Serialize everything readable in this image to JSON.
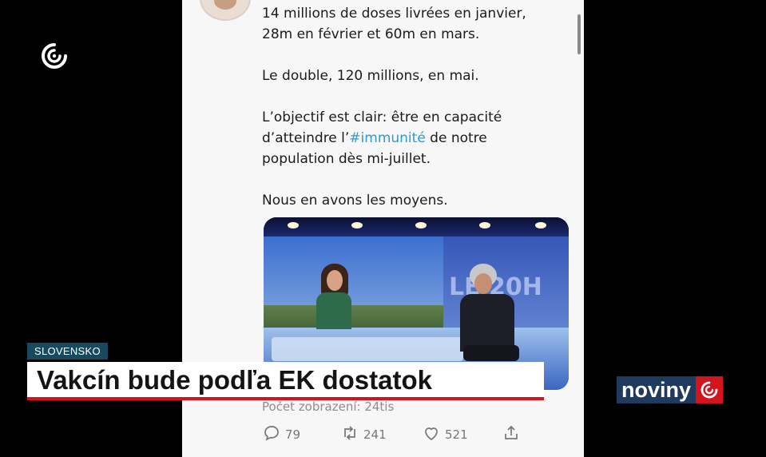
{
  "tweet": {
    "lines": [
      "14 millions de doses livrées en janvier,",
      "28m en février et 60m en mars.",
      "Le double, 120 millions, en mai.",
      "L’objectif est clair: être en capacité",
      "d’atteindre l’",
      "#immunité",
      " de notre",
      "population dès mi-juillet.",
      "Nous en avons les moyens."
    ],
    "views": "Počet zobrazení: 24tis",
    "reply_count": "79",
    "retweet_count": "241",
    "like_count": "521"
  },
  "video": {
    "logo_text": "LE 20H"
  },
  "chyron": {
    "tag": "SLOVENSKO",
    "headline": "Vakcín bude podľa EK dostatok"
  },
  "brand": {
    "noviny_text": "noviny",
    "accent_color": "#d4141c",
    "navy_color": "#1f3a5c",
    "network_logo_icon": "swirl-logo-icon"
  }
}
